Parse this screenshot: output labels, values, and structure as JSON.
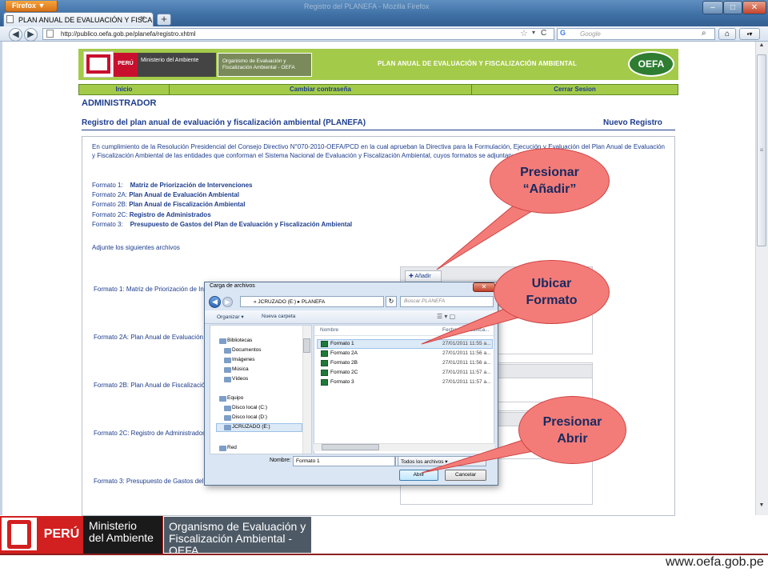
{
  "browser": {
    "menu_button": "Firefox ▼",
    "tab_title": "PLAN ANUAL DE EVALUACIÓN Y FISCAL...",
    "window_title": "Registro del PLANEFA - Mozilla Firefox",
    "url": "http://publico.oefa.gob.pe/planefa/registro.xhtml",
    "search_placeholder": "Google",
    "search_engine": "G"
  },
  "banner": {
    "peru": "PERÚ",
    "ministerio": "Ministerio del Ambiente",
    "organismo": "Organismo de Evaluación y Fiscalización Ambiental - OEFA",
    "title": "PLAN ANUAL DE EVALUACIÓN Y FISCALIZACIÓN AMBIENTAL",
    "logo": "OEFA"
  },
  "menu": {
    "inicio": "Inicio",
    "cambiar": "Cambiar contraseña",
    "cerrar": "Cerrar Sesion"
  },
  "page": {
    "role": "ADMINISTRADOR",
    "subtitle": "Registro del plan anual de evaluación y fiscalización ambiental (PLANEFA)",
    "nuevo_registro": "Nuevo Registro",
    "intro": "En cumplimiento de la Resolución Presidencial del Consejo Directivo N°070-2010-OEFA/PCD en la cual aprueban la Directiva para la Formulación, Ejecución y Evaluación del Plan Anual de Evaluación y Fiscalización Ambiental de las entidades que conforman el Sistema Nacional de Evaluación y Fiscalización Ambiental, cuyos formatos se adjuntan:",
    "formats": [
      {
        "code": "Formato 1:",
        "name": "Matriz de Priorización de Intervenciones"
      },
      {
        "code": "Formato 2A:",
        "name": "Plan Anual de Evaluación Ambiental"
      },
      {
        "code": "Formato 2B:",
        "name": "Plan Anual de Fiscalización Ambiental"
      },
      {
        "code": "Formato 2C:",
        "name": "Registro de Administrados"
      },
      {
        "code": "Formato 3:",
        "name": "Presupuesto de Gastos del Plan de Evaluación y Fiscalización Ambiental"
      }
    ],
    "adjunte": "Adjunte los siguientes archivos",
    "rows": [
      "Formato 1: Matriz de Priorización de Intervenciones del Plan de Evaluación y Fiscalización Ambiental",
      "Formato 2A: Plan Anual de Evaluación Ambiental",
      "Formato 2B: Plan Anual de Fiscalización Ambiental",
      "Formato 2C: Registro de Administrados",
      "Formato 3: Presupuesto de Gastos del Plan de Evaluación y Fiscalización Ambiental"
    ],
    "anadir": "Añadir"
  },
  "dialog": {
    "title": "Carga de archivos",
    "path": "« JCRUZADO (E:) ▸ PLANEFA",
    "search_placeholder": "Buscar PLANEFA",
    "organizar": "Organizar ▾",
    "nueva_carpeta": "Nueva carpeta",
    "nav": {
      "bibliotecas": "Bibliotecas",
      "documentos": "Documentos",
      "imagenes": "Imágenes",
      "musica": "Música",
      "videos": "Vídeos",
      "equipo": "Equipo",
      "disco_c": "Disco local (C:)",
      "disco_d": "Disco local (D:)",
      "jcruzado": "JCRUZADO (E:)",
      "red": "Red"
    },
    "col_nombre": "Nombre",
    "col_fecha": "Fecha de modifica...",
    "files": [
      {
        "name": "Formato 1",
        "date": "27/01/2011 11:55 a..."
      },
      {
        "name": "Formato 2A",
        "date": "27/01/2011 11:56 a..."
      },
      {
        "name": "Formato 2B",
        "date": "27/01/2011 11:56 a..."
      },
      {
        "name": "Formato 2C",
        "date": "27/01/2011 11:57 a..."
      },
      {
        "name": "Formato 3",
        "date": "27/01/2011 11:57 a..."
      }
    ],
    "nombre_label": "Nombre:",
    "nombre_value": "Formato 1",
    "tipo": "Todos los archivos",
    "abrir": "Abrir",
    "cancelar": "Cancelar"
  },
  "callouts": {
    "c1_line1": "Presionar",
    "c1_line2": "“Añadir”",
    "c2_line1": "Ubicar",
    "c2_line2": "Formato",
    "c3_line1": "Presionar",
    "c3_line2": "Abrir"
  },
  "footer": {
    "peru": "PERÚ",
    "ministerio_1": "Ministerio",
    "ministerio_2": "del Ambiente",
    "organismo_1": "Organismo de Evaluación y",
    "organismo_2": "Fiscalización Ambiental -OEFA",
    "url": "www.oefa.gob.pe"
  },
  "colors": {
    "banner_green": "#a4ca4a",
    "link_blue": "#1c3c8c",
    "callout": "#f47c78",
    "footer_red": "#d21f1f"
  }
}
